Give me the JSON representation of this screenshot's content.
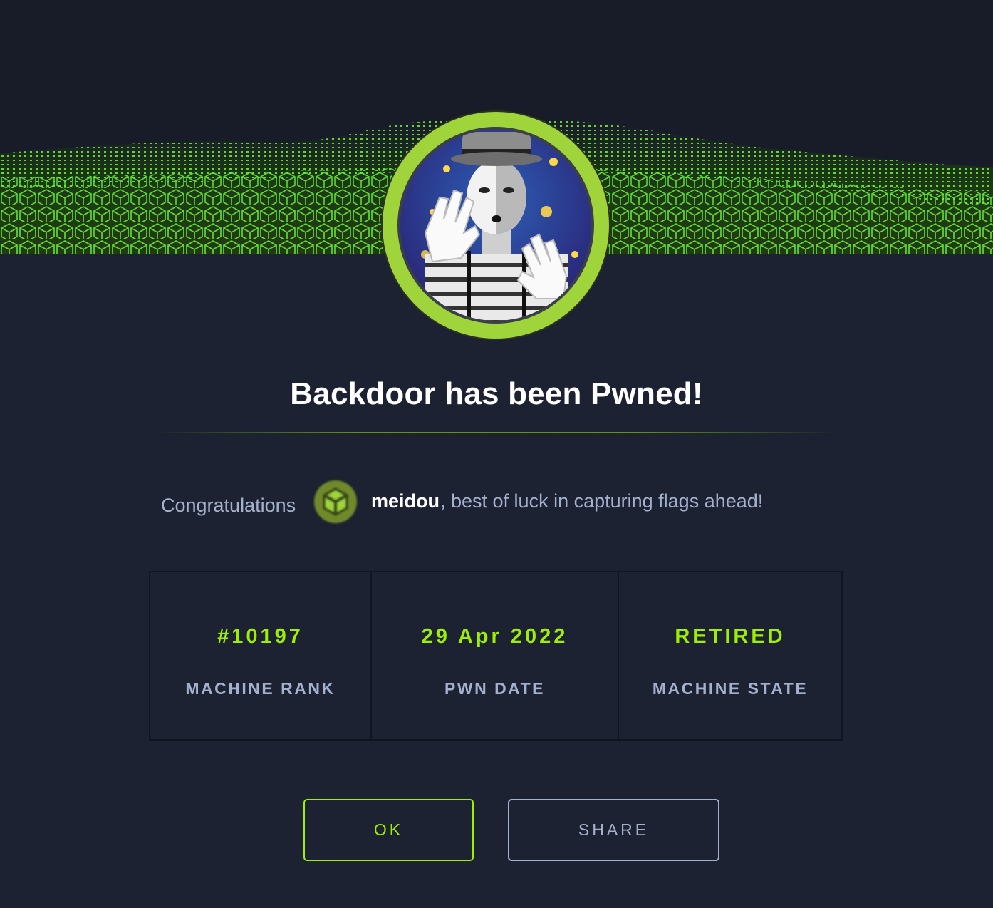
{
  "modal": {
    "title": "Backdoor has been Pwned!",
    "congrats_label": "Congratulations",
    "username": "meidou",
    "congrats_rest": ", best of luck in capturing flags ahead!"
  },
  "stats": [
    {
      "value": "#10197",
      "label": "MACHINE RANK"
    },
    {
      "value": "29 Apr 2022",
      "label": "PWN DATE"
    },
    {
      "value": "RETIRED",
      "label": "MACHINE STATE"
    }
  ],
  "buttons": {
    "ok": "OK",
    "share": "SHARE"
  },
  "colors": {
    "accent": "#9fef00",
    "muted": "#a4b1cd",
    "background": "#1d2232",
    "avatar_ring": "#9fd43a"
  },
  "icons": {
    "banner": "green-cube-wave-banner",
    "avatar": "mime-machine-avatar",
    "user_badge": "green-cube-badge-icon"
  }
}
